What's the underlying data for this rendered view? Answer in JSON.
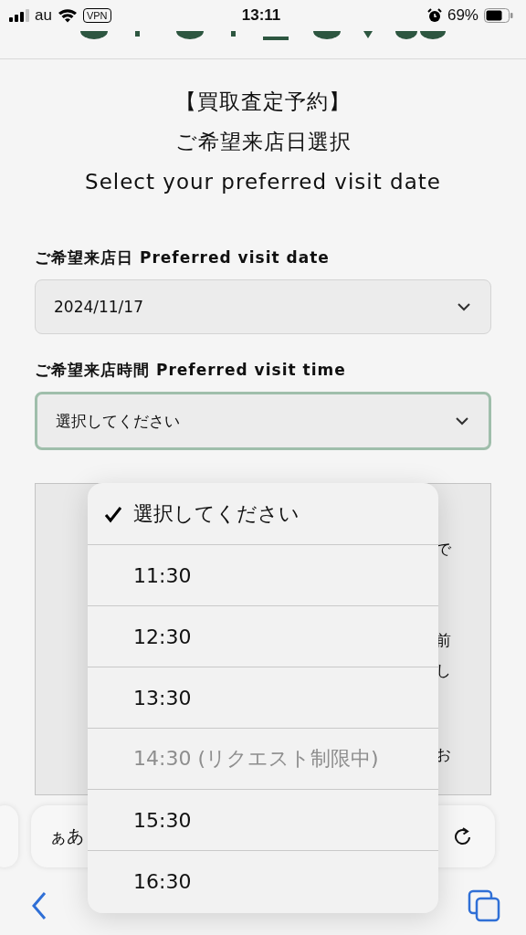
{
  "status_bar": {
    "carrier": "au",
    "vpn": "VPN",
    "time": "13:11",
    "battery": "69%"
  },
  "page": {
    "title_lines": [
      "【買取査定予約】",
      "ご希望来店日選択",
      "Select your preferred visit date"
    ],
    "date_field": {
      "label": "ご希望来店日 Preferred visit date",
      "value": "2024/11/17",
      "focused": false
    },
    "time_field": {
      "label": "ご希望来店時間 Preferred visit time",
      "value": "選択してください",
      "focused": true
    },
    "notice_fragments": [
      "で",
      "前",
      "し",
      "お"
    ]
  },
  "dropdown": {
    "options": [
      {
        "label": "選択してください",
        "selected": true,
        "disabled": false
      },
      {
        "label": "11:30",
        "selected": false,
        "disabled": false
      },
      {
        "label": "12:30",
        "selected": false,
        "disabled": false
      },
      {
        "label": "13:30",
        "selected": false,
        "disabled": false
      },
      {
        "label": "14:30 (リクエスト制限中)",
        "selected": false,
        "disabled": true
      },
      {
        "label": "15:30",
        "selected": false,
        "disabled": false
      },
      {
        "label": "16:30",
        "selected": false,
        "disabled": false
      }
    ]
  },
  "browser_bar": {
    "text_size_button": "ぁあ"
  }
}
